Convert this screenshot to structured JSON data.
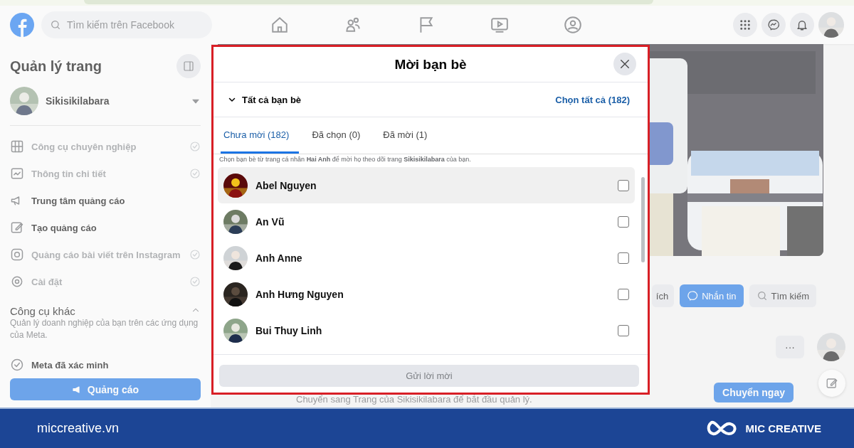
{
  "header": {
    "search_placeholder": "Tìm kiếm trên Facebook"
  },
  "sidebar": {
    "title": "Quản lý trang",
    "page_name": "Sikisikilabara",
    "items": [
      {
        "kind": "grid",
        "label": "Công cụ chuyên nghiệp",
        "disabled": true
      },
      {
        "kind": "insights",
        "label": "Thông tin chi tiết",
        "disabled": true
      },
      {
        "kind": "megaphone",
        "label": "Trung tâm quảng cáo",
        "disabled": false
      },
      {
        "kind": "edit",
        "label": "Tạo quảng cáo",
        "disabled": false
      },
      {
        "kind": "instagram",
        "label": "Quảng cáo bài viết trên Instagram",
        "disabled": true
      },
      {
        "kind": "gear",
        "label": "Cài đặt",
        "disabled": true
      }
    ],
    "other_tools": {
      "title": "Công cụ khác",
      "description": "Quản lý doanh nghiệp của bạn trên các ứng dụng của Meta.",
      "expanded": true
    },
    "verified": "Meta đã xác minh",
    "ad_button": "Quảng cáo"
  },
  "page": {
    "actions": [
      {
        "kind": "plain",
        "label": "ích"
      },
      {
        "kind": "message",
        "label": "Nhắn tin"
      },
      {
        "kind": "search",
        "label": "Tìm kiếm"
      }
    ],
    "more": "···",
    "notice": "Chuyển sang Trang của Sikisikilabara để bắt đầu quản lý.",
    "switch_button": "Chuyển ngay"
  },
  "dialog": {
    "title": "Mời bạn bè",
    "filter": "Tất cả bạn bè",
    "select_all": "Chọn tất cả (182)",
    "tabs": [
      {
        "label": "Chưa mời (182)",
        "selected": true
      },
      {
        "label": "Đã chọn (0)",
        "selected": false
      },
      {
        "label": "Đã mời (1)",
        "selected": false
      }
    ],
    "hint": "Chọn bạn bè từ trang cá nhân **Hai Anh** để mời họ theo dõi trang **Sikisikilabara** của bạn.",
    "friends": [
      {
        "name": "Abel Nguyen",
        "checked": false,
        "hovered": true
      },
      {
        "name": "An Vũ",
        "checked": false,
        "hovered": false
      },
      {
        "name": "Anh Anne",
        "checked": false,
        "hovered": false
      },
      {
        "name": "Anh Hưng Nguyen",
        "checked": false,
        "hovered": false
      },
      {
        "name": "Bui Thuy Linh",
        "checked": false,
        "hovered": false
      }
    ],
    "send_button": "Gửi lời mời",
    "send_disabled": true
  },
  "footer": {
    "site": "miccreative.vn",
    "brand": "MIC CREATIVE"
  }
}
